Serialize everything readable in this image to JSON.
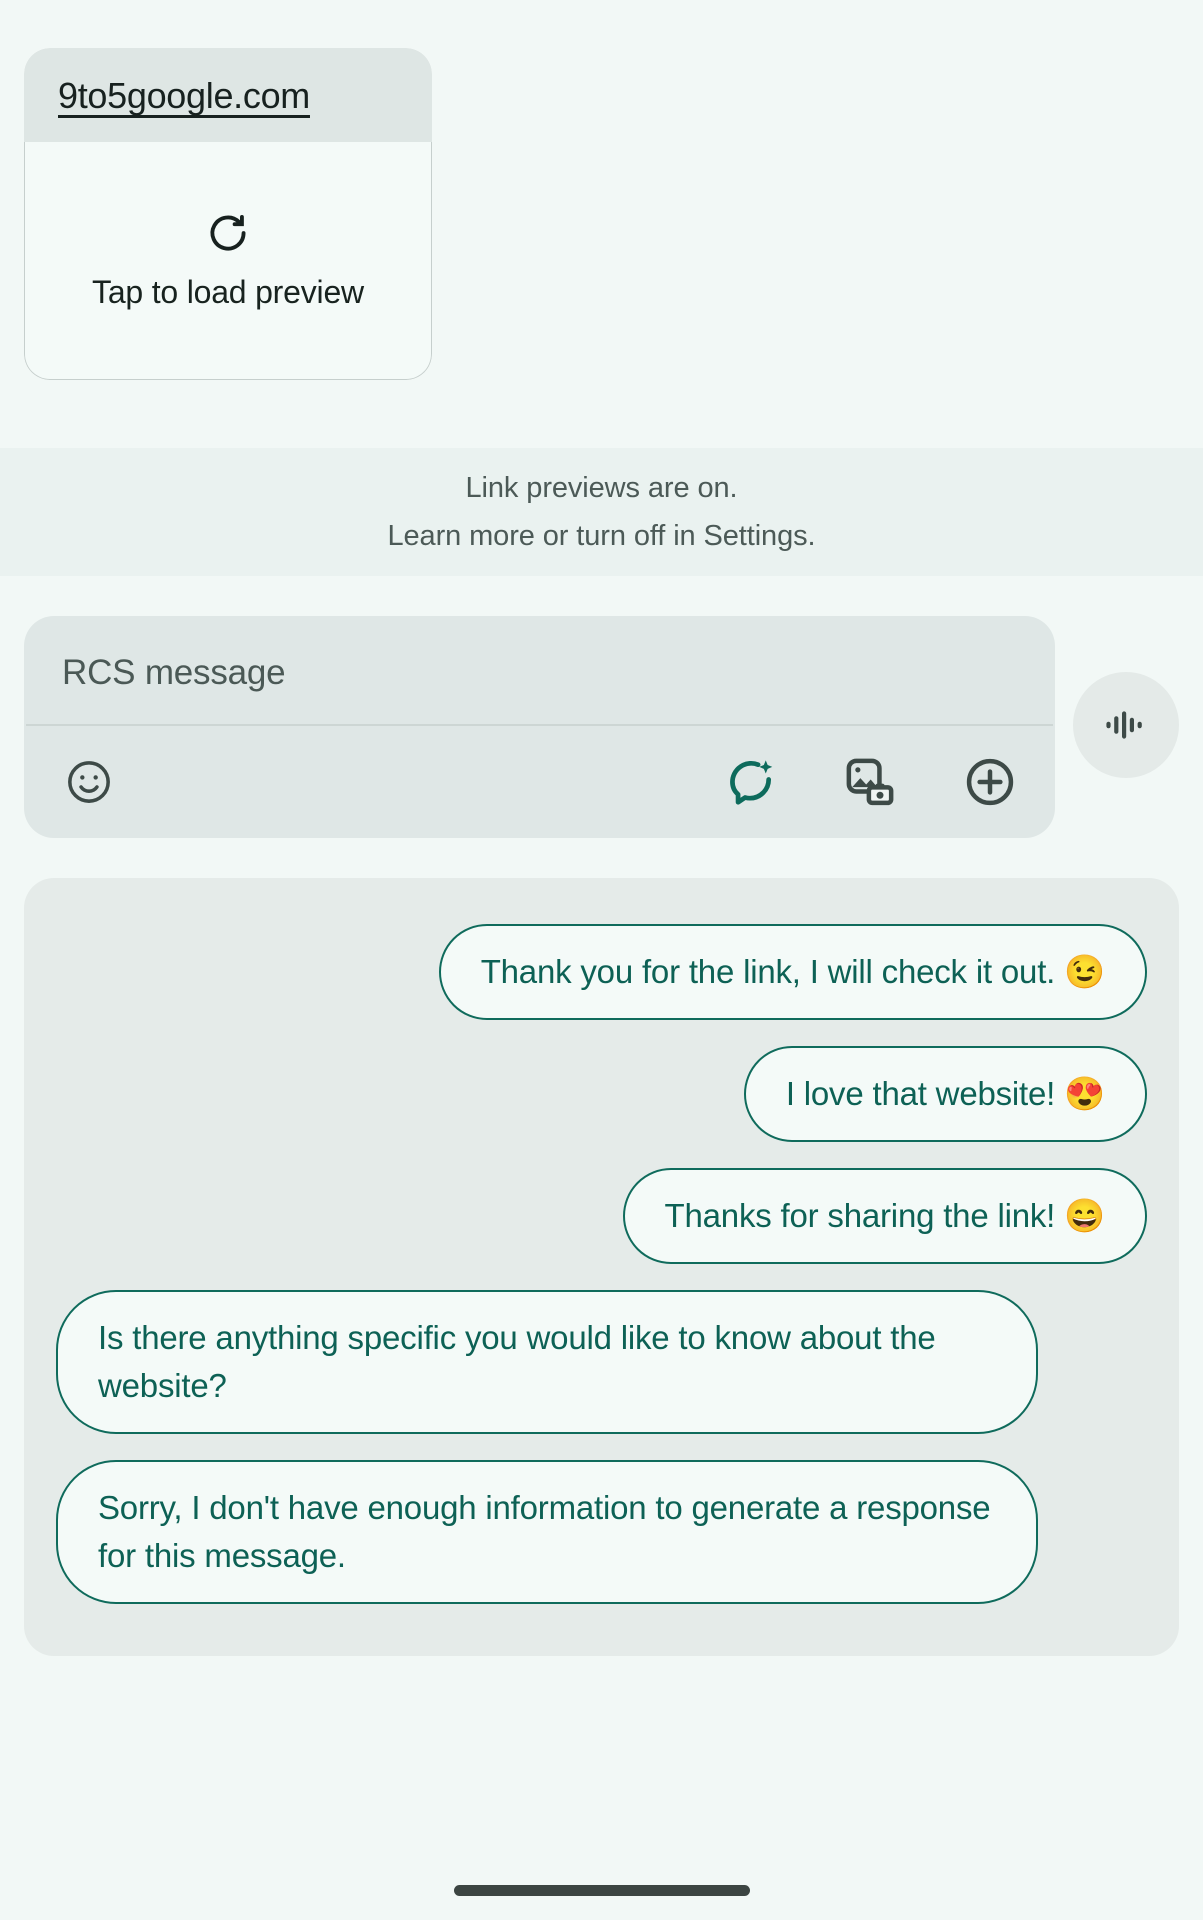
{
  "link_preview": {
    "url": "9to5google.com",
    "cta_label": "Tap to load preview",
    "refresh_icon": "refresh-icon"
  },
  "banner": {
    "line1": "Link previews are on.",
    "line2": "Learn more or turn off in Settings."
  },
  "compose": {
    "placeholder": "RCS message",
    "emoji_icon": "emoji-smiley-icon",
    "magic_compose_icon": "magic-compose-sparkle-icon",
    "gallery_icon": "gallery-camera-icon",
    "plus_icon": "plus-circle-icon",
    "voice_icon": "voice-waveform-icon"
  },
  "suggestions": {
    "items": [
      {
        "text": "Thank you for the link, I will check it out. 😉",
        "wide": false
      },
      {
        "text": "I love that website! 😍",
        "wide": false
      },
      {
        "text": "Thanks for sharing the link! 😄",
        "wide": false
      },
      {
        "text": "Is there anything specific you would like to know about the website?",
        "wide": true
      },
      {
        "text": "Sorry, I don't have enough information to generate a response for this message.",
        "wide": true
      }
    ]
  },
  "nav": {
    "handle": "gesture-nav-handle"
  },
  "colors": {
    "background": "#f2f8f6",
    "accent_teal": "#0d6155",
    "compose_bg": "#dfe7e6",
    "banner_bg": "#eaf2f0",
    "suggestion_panel_bg": "#e5ebe9"
  }
}
